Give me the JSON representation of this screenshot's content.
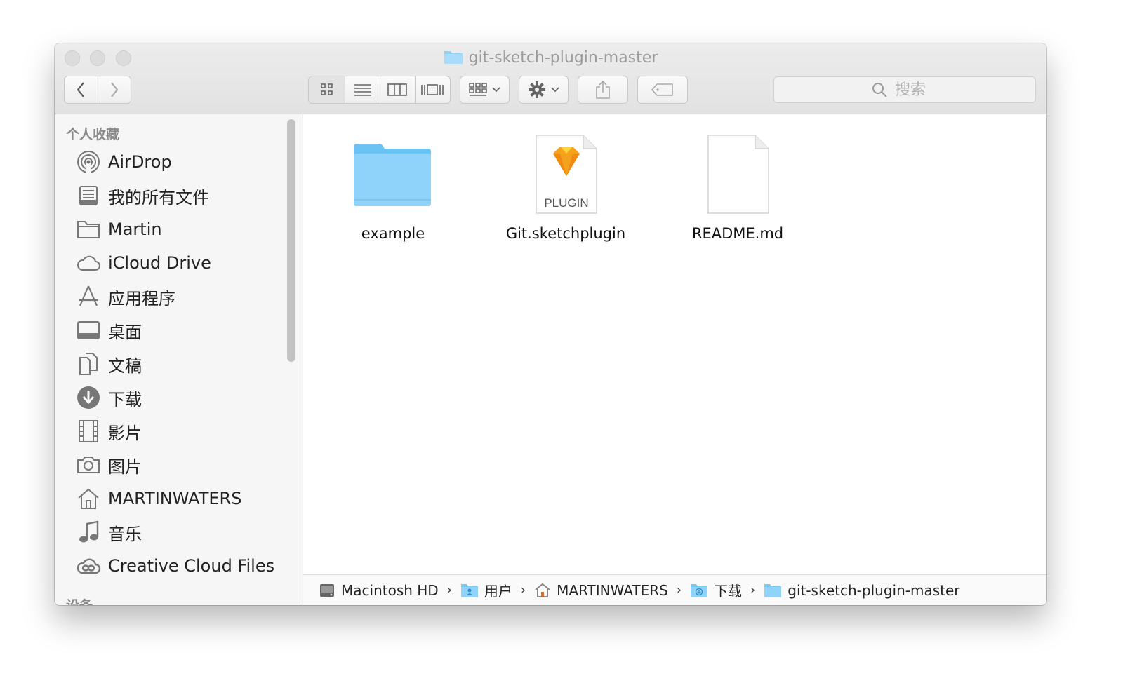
{
  "window": {
    "title": "git-sketch-plugin-master",
    "title_icon": "folder-icon"
  },
  "toolbar": {
    "back_icon": "chevron-left-icon",
    "forward_icon": "chevron-right-icon",
    "view_modes": [
      "icon-view",
      "list-view",
      "column-view",
      "cover-flow-view"
    ],
    "arrange_icon": "arrange-icon",
    "action_icon": "gear-icon",
    "share_icon": "share-icon",
    "tag_icon": "tag-icon",
    "search_placeholder": "搜索"
  },
  "sidebar": {
    "favorites_title": "个人收藏",
    "devices_title": "设备",
    "items": [
      {
        "label": "AirDrop",
        "icon": "airdrop-icon"
      },
      {
        "label": "我的所有文件",
        "icon": "all-files-icon"
      },
      {
        "label": "Martin",
        "icon": "folder-icon"
      },
      {
        "label": "iCloud Drive",
        "icon": "cloud-icon"
      },
      {
        "label": "应用程序",
        "icon": "applications-icon"
      },
      {
        "label": "桌面",
        "icon": "desktop-icon"
      },
      {
        "label": "文稿",
        "icon": "documents-icon"
      },
      {
        "label": "下载",
        "icon": "download-icon"
      },
      {
        "label": "影片",
        "icon": "movies-icon"
      },
      {
        "label": "图片",
        "icon": "camera-icon"
      },
      {
        "label": "MARTINWATERS",
        "icon": "home-icon"
      },
      {
        "label": "音乐",
        "icon": "music-icon"
      },
      {
        "label": "Creative Cloud Files",
        "icon": "creative-cloud-icon"
      }
    ]
  },
  "files": [
    {
      "name": "example",
      "icon": "folder-icon"
    },
    {
      "name": "Git.sketchplugin",
      "icon": "sketch-plugin-icon",
      "badge": "PLUGIN"
    },
    {
      "name": "README.md",
      "icon": "document-icon"
    }
  ],
  "pathbar": [
    {
      "label": "Macintosh HD",
      "icon": "hard-drive-icon"
    },
    {
      "label": "用户",
      "icon": "users-folder-icon"
    },
    {
      "label": "MARTINWATERS",
      "icon": "home-icon"
    },
    {
      "label": "下载",
      "icon": "downloads-folder-icon"
    },
    {
      "label": "git-sketch-plugin-master",
      "icon": "folder-icon"
    }
  ],
  "path_separator": "›"
}
